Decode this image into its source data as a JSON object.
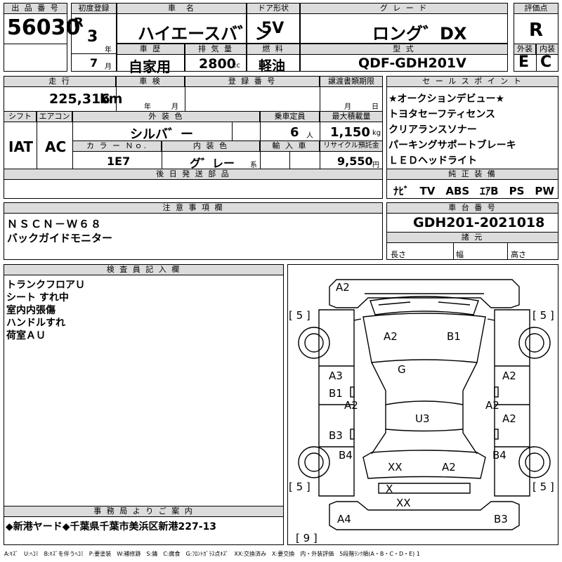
{
  "header": {
    "lot_no_label": "出 品 番 号",
    "lot_no": "56030",
    "first_reg_label": "初度登録",
    "era": "R",
    "year": "3",
    "year_unit": "年",
    "month": "7",
    "month_unit": "月",
    "car_name_label": "車　名",
    "car_name": "ハイエースバ゛ン",
    "door_label": "ドア形状",
    "door": "5V",
    "grade_label": "グ レ ー ド",
    "grade": "ロング゛DX",
    "score_label": "評価点",
    "score": "R",
    "history_label": "車 歴",
    "history": "自家用",
    "displacement_label": "排 気 量",
    "displacement": "2800",
    "cc_unit": "cc",
    "fuel_label": "燃 料",
    "fuel": "軽油",
    "model_label": "型 式",
    "model": "QDF-GDH201V",
    "exterior_label": "外装",
    "exterior": "E",
    "interior_label": "内装",
    "interior": "C"
  },
  "row2": {
    "mileage_label": "走 行",
    "mileage": "225,316",
    "km_unit": "km",
    "inspection_label": "車 検",
    "insp_year_unit": "年",
    "insp_month_unit": "月",
    "plate_label": "登 録 番 号",
    "transfer_label": "譲渡書類期限",
    "transfer_month_unit": "月",
    "transfer_day_unit": "日",
    "shift_label": "シフト",
    "shift": "IAT",
    "ac_label": "エアコン",
    "ac": "AC",
    "color_label": "外 装 色",
    "color": "シルバ゛ー",
    "capacity_label": "乗車定員",
    "capacity": "6",
    "capacity_unit": "人",
    "maxload_label": "最大積載量",
    "maxload": "1,150",
    "kg_unit": "kg",
    "colorno_label": "カ ラ ー Ｎｏ.",
    "colorno": "1E7",
    "intcolor_label": "内 装 色",
    "intcolor": "グ゛レー",
    "kei_unit": "系",
    "import_label": "輸 入 車",
    "recycle_label": "リサイクル預託金",
    "recycle": "9,550",
    "yen_unit": "円",
    "later_parts_label": "後 日 発 送 部 品"
  },
  "sales_points": {
    "label": "セ ー ル ス ポ イ ン ト",
    "items": [
      "★オークションデビュー★",
      "トヨタセーフティセンス",
      "クリアランスソナー",
      "パーキングサポートブレーキ",
      "ＬＥＤヘッドライト"
    ]
  },
  "equipment": {
    "label": "純 正 装 備",
    "value": "ﾅﾋﾞ　TV　ABS　ｴｱB　PS　PW"
  },
  "notes": {
    "label": "注 意 事 項 欄",
    "lines": [
      "ＮＳＣＮ－Ｗ６８",
      "バックガイドモニター"
    ]
  },
  "chassis": {
    "label": "車 台 番 号",
    "value": "GDH201-2021018",
    "dims_label": "諸 元",
    "length_label": "長さ",
    "width_label": "幅",
    "height_label": "高さ"
  },
  "inspector": {
    "label": "検 査 員 記 入 欄",
    "lines": [
      "トランクフロアＵ",
      "シート すれ中",
      "室内内張傷",
      "ハンドルすれ",
      "荷室ＡＵ"
    ]
  },
  "diagram": {
    "bracket_left_top": "[ 5 ]",
    "bracket_right_top": "[ 5 ]",
    "bracket_left_bottom": "[ 5 ]",
    "bracket_right_bottom": "[ 5 ]",
    "bracket_bottom": "[ 9 ]",
    "marks": [
      "A2",
      "A2",
      "B1",
      "G",
      "A3",
      "B1",
      "A2",
      "A2",
      "A2",
      "U3",
      "A2",
      "B3",
      "B4",
      "B4",
      "XX",
      "A2",
      "X",
      "XX",
      "A4",
      "B3"
    ]
  },
  "office": {
    "label": "事 務 局 よ り ご 案 内",
    "text": "◆新港ヤード◆千葉県千葉市美浜区新港227-13"
  },
  "legend": "A:ｷｽﾞ　U:ﾍｺﾐ　B:ｷｽﾞを伴うﾍｺﾐ　P:要塗装　W:補修跡　S:錆　C:腐食　G:ﾌﾛﾝﾄｶﾞﾗｽ点ｷｽﾞ　XX:交換済み　X:要交換　内・外装評価　5段階ﾗﾝｸ順(A・B・C・D・E) 1"
}
